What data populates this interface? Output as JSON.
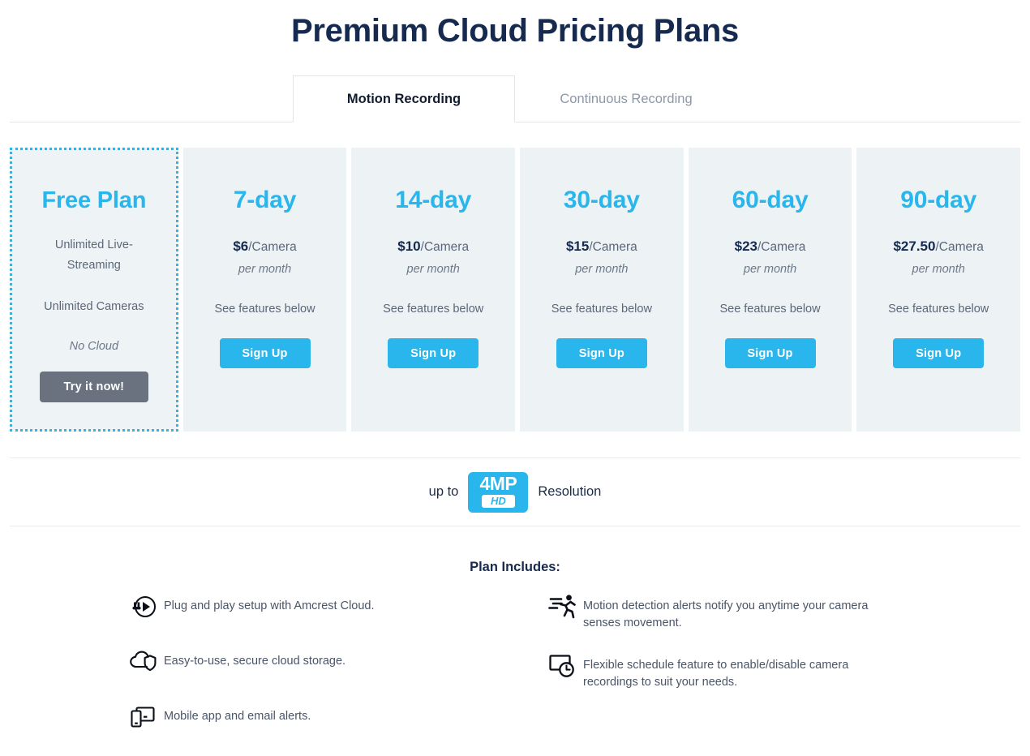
{
  "page": {
    "title": "Premium Cloud Pricing Plans"
  },
  "tabs": [
    {
      "label": "Motion Recording",
      "active": true
    },
    {
      "label": "Continuous Recording",
      "active": false
    }
  ],
  "plans": [
    {
      "name": "Free Plan",
      "line1": "Unlimited Live-Streaming",
      "line2": "Unlimited Cameras",
      "line3": "No Cloud",
      "cta": "Try it now!"
    },
    {
      "name": "7-day",
      "price_amount": "$6",
      "price_unit": "/Camera",
      "period": "per month",
      "features_note": "See features below",
      "cta": "Sign Up"
    },
    {
      "name": "14-day",
      "price_amount": "$10",
      "price_unit": "/Camera",
      "period": "per month",
      "features_note": "See features below",
      "cta": "Sign Up"
    },
    {
      "name": "30-day",
      "price_amount": "$15",
      "price_unit": "/Camera",
      "period": "per month",
      "features_note": "See features below",
      "cta": "Sign Up"
    },
    {
      "name": "60-day",
      "price_amount": "$23",
      "price_unit": "/Camera",
      "period": "per month",
      "features_note": "See features below",
      "cta": "Sign Up"
    },
    {
      "name": "90-day",
      "price_amount": "$27.50",
      "price_unit": "/Camera",
      "period": "per month",
      "features_note": "See features below",
      "cta": "Sign Up"
    }
  ],
  "resolution": {
    "prefix": "up to",
    "badge_main": "4MP",
    "badge_sub": "HD",
    "suffix": "Resolution"
  },
  "includes": {
    "title": "Plan Includes:",
    "left": [
      {
        "icon": "plug-play-icon",
        "text": "Plug and play setup with Amcrest Cloud."
      },
      {
        "icon": "cloud-shield-icon",
        "text": "Easy-to-use, secure cloud storage."
      },
      {
        "icon": "mobile-devices-icon",
        "text": "Mobile app and email alerts."
      }
    ],
    "right": [
      {
        "icon": "motion-running-icon",
        "text": "Motion detection alerts notify you anytime your camera senses movement."
      },
      {
        "icon": "schedule-clock-icon",
        "text": "Flexible schedule feature to enable/disable camera recordings to suit your needs."
      }
    ]
  },
  "colors": {
    "accent": "#29b6ec",
    "title": "#152a4e",
    "card_bg": "#edf2f5",
    "free_button": "#6a7280"
  }
}
